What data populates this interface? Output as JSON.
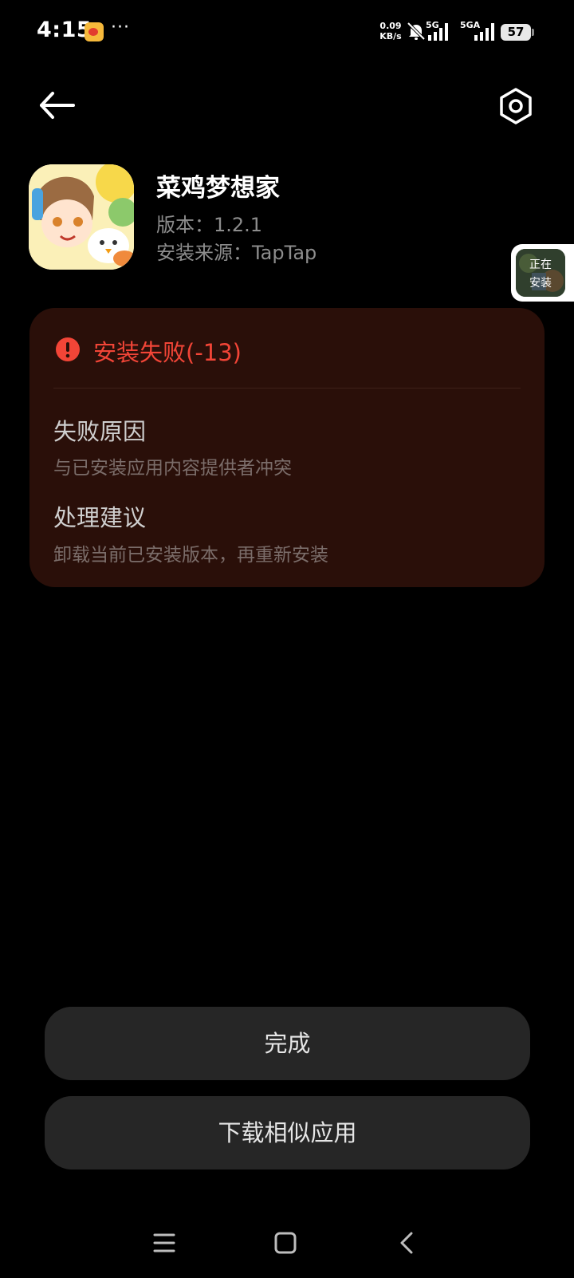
{
  "status_bar": {
    "time": "4:15",
    "net_speed_value": "0.09",
    "net_speed_unit": "KB/s",
    "sim1_label": "5G",
    "sim2_label": "5GA",
    "battery": "57"
  },
  "app": {
    "name": "菜鸡梦想家",
    "version": "版本：1.2.1",
    "source": "安装来源：TapTap"
  },
  "floating_widget": {
    "line1": "正在",
    "line2": "安装"
  },
  "error": {
    "title": "安装失败(-13)",
    "reason_title": "失败原因",
    "reason_desc": "与已安装应用内容提供者冲突",
    "advice_title": "处理建议",
    "advice_desc": "卸载当前已安装版本，再重新安装"
  },
  "buttons": {
    "done": "完成",
    "download_similar": "下载相似应用"
  },
  "colors": {
    "error_red": "#f24537",
    "card_bg": "#2a0f09",
    "button_bg": "#262626"
  },
  "icons": {
    "back": "arrow-left-icon",
    "settings": "hexagon-gear-icon",
    "error": "exclamation-circle-icon",
    "nav_menu": "menu-icon",
    "nav_home": "square-home-icon",
    "nav_back": "chevron-left-icon"
  }
}
